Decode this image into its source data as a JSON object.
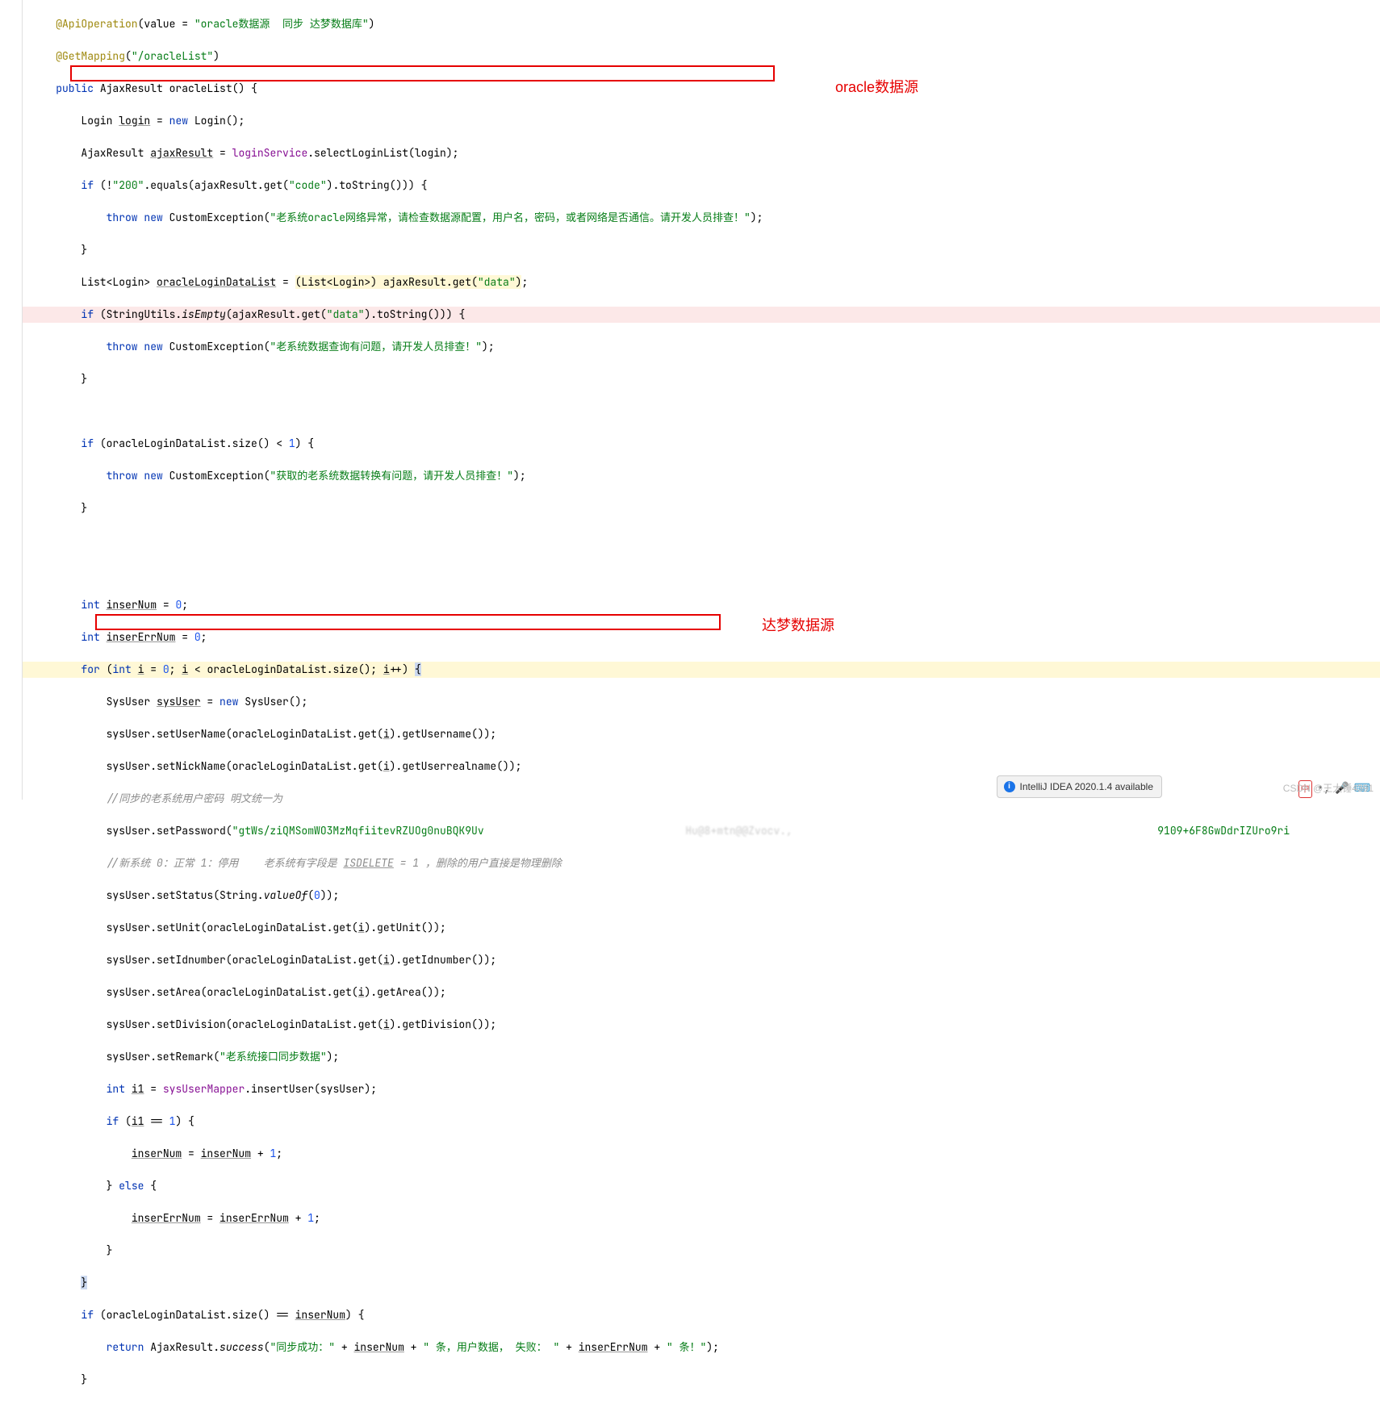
{
  "annotations": {
    "top": "oracle数据源",
    "bottom": "达梦数据源"
  },
  "notif": {
    "text": "IntelliJ IDEA 2020.1.4 available"
  },
  "watermark": "CSDN @王大锤4391",
  "code": {
    "l1": {
      "ann": "@ApiOperation",
      "p1": "(value = ",
      "s1": "\"oracle数据源  同步 达梦数据库\"",
      "p2": ")"
    },
    "l2": {
      "ann": "@GetMapping",
      "p1": "(",
      "s1": "\"/oracleList\"",
      "p2": ")"
    },
    "l3": {
      "k1": "public",
      "t1": " AjaxResult ",
      "m": "oracleList",
      "p": "() {"
    },
    "l4": {
      "t1": "Login ",
      "v": "login",
      "t2": " = ",
      "k1": "new",
      "t3": " Login();"
    },
    "l5": {
      "t1": "AjaxResult ",
      "v": "ajaxResult",
      "t2": " = ",
      "f": "loginService",
      "t3": ".selectLoginList(login);"
    },
    "l6": {
      "k1": "if",
      "t1": " (!",
      "s1": "\"200\"",
      "t2": ".equals(ajaxResult.get(",
      "s2": "\"code\"",
      "t3": ").toString())) {"
    },
    "l7": {
      "k1": "throw new",
      "t1": " CustomException(",
      "s1": "\"老系统oracle网络异常，请检查数据源配置，用户名，密码，或者网络是否通信。请开发人员排查！\"",
      "t2": ");"
    },
    "l8": {
      "t": "}"
    },
    "l9": {
      "t1": "List<Login> ",
      "v": "oracleLoginDataList",
      "t2": " = ",
      "hl1": "(List<Login>) ajaxResult.get(",
      "s1": "\"data\"",
      "hl2": ")",
      "t3": ";"
    },
    "l10": {
      "k1": "if",
      "t1": " (StringUtils.",
      "m": "isEmpty",
      "t2": "(ajaxResult.get(",
      "s1": "\"data\"",
      "t3": ").toString())) {"
    },
    "l11": {
      "k1": "throw new",
      "t1": " CustomException(",
      "s1": "\"老系统数据查询有问题，请开发人员排查！\"",
      "t2": ");"
    },
    "l12": {
      "t": "}"
    },
    "l13": "",
    "l14": {
      "k1": "if",
      "t1": " (oracleLoginDataList.size() < ",
      "n": "1",
      "t2": ") {"
    },
    "l15": {
      "k1": "throw new",
      "t1": " CustomException(",
      "s1": "\"获取的老系统数据转换有问题，请开发人员排查！\"",
      "t2": ");"
    },
    "l16": {
      "t": "}"
    },
    "l17": "",
    "l18": "",
    "l19": {
      "k1": "int",
      "t1": " ",
      "v": "inserNum",
      "t2": " = ",
      "n": "0",
      "t3": ";"
    },
    "l20": {
      "k1": "int",
      "t1": " ",
      "v": "inserErrNum",
      "t2": " = ",
      "n": "0",
      "t3": ";"
    },
    "l21": {
      "k1": "for",
      "t1": " (",
      "k2": "int",
      "t2": " ",
      "v1": "i",
      "t3": " = ",
      "n1": "0",
      "t4": "; ",
      "v2": "i",
      "t5": " < oracleLoginDataList.size(); ",
      "v3": "i",
      "t6": "++) ",
      "br": "{"
    },
    "l22": {
      "t1": "SysUser ",
      "v": "sysUser",
      "t2": " = ",
      "k1": "new",
      "t3": " SysUser();"
    },
    "l23": {
      "t1": "sysUser.setUserName(oracleLoginDataList.get(",
      "v": "i",
      "t2": ").getUsername());"
    },
    "l24": {
      "t1": "sysUser.setNickName(oracleLoginDataList.get(",
      "v": "i",
      "t2": ").getUserrealname());"
    },
    "l25": {
      "c": "//同步的老系统用户密码 明文统一为"
    },
    "l26": {
      "t1": "sysUser.setPassword(",
      "s1": "\"gtWs/ziQMSomWO3MzMqfiitevRZUOg0nuBQK9Uv",
      "mask": "                                Hu@8+mtn@@Zvocv.,                                                          ",
      "s2": "9109+6F8GwDdrIZUro9ri"
    },
    "l27": {
      "c1": "//新系统 0：正常 1：停用    老系统有字段是 ",
      "c2": "ISDELETE",
      "c3": " = 1 ，删除的用户直接是物理删除"
    },
    "l28": {
      "t1": "sysUser.setStatus(String.",
      "m": "valueOf",
      "t2": "(",
      "n": "0",
      "t3": "));"
    },
    "l29": {
      "t1": "sysUser.setUnit(oracleLoginDataList.get(",
      "v": "i",
      "t2": ").getUnit());"
    },
    "l30": {
      "t1": "sysUser.setIdnumber(oracleLoginDataList.get(",
      "v": "i",
      "t2": ").getIdnumber());"
    },
    "l31": {
      "t1": "sysUser.setArea(oracleLoginDataList.get(",
      "v": "i",
      "t2": ").getArea());"
    },
    "l32": {
      "t1": "sysUser.setDivision(oracleLoginDataList.get(",
      "v": "i",
      "t2": ").getDivision());"
    },
    "l33": {
      "t1": "sysUser.setRemark(",
      "s1": "\"老系统接口同步数据\"",
      "t2": ");"
    },
    "l34": {
      "k1": "int",
      "t1": " ",
      "v1": "i1",
      "t2": " = ",
      "f": "sysUserMapper",
      "t3": ".insertUser(sysUser);"
    },
    "l35": {
      "k1": "if",
      "t1": " (",
      "v": "i1",
      "t2": " == ",
      "n": "1",
      "t3": ") {"
    },
    "l36": {
      "v1": "inserNum",
      "t1": " = ",
      "v2": "inserNum",
      "t2": " + ",
      "n": "1",
      "t3": ";"
    },
    "l37": {
      "t1": "} ",
      "k1": "else",
      "t2": " {"
    },
    "l38": {
      "v1": "inserErrNum",
      "t1": " = ",
      "v2": "inserErrNum",
      "t2": " + ",
      "n": "1",
      "t3": ";"
    },
    "l39": {
      "t": "}"
    },
    "l40": {
      "t": "}"
    },
    "l41": {
      "k1": "if",
      "t1": " (oracleLoginDataList.size() == ",
      "v": "inserNum",
      "t2": ") {"
    },
    "l42": {
      "k1": "return",
      "t1": " AjaxResult.",
      "m": "success",
      "t2": "(",
      "s1": "\"同步成功：\"",
      "t3": " + ",
      "v1": "inserNum",
      "t4": " + ",
      "s2": "\" 条，用户数据， 失败： \"",
      "t5": " + ",
      "v2": "inserErrNum",
      "t6": " + ",
      "s3": "\" 条！\"",
      "t7": ");"
    },
    "l43": {
      "t": "}"
    }
  }
}
